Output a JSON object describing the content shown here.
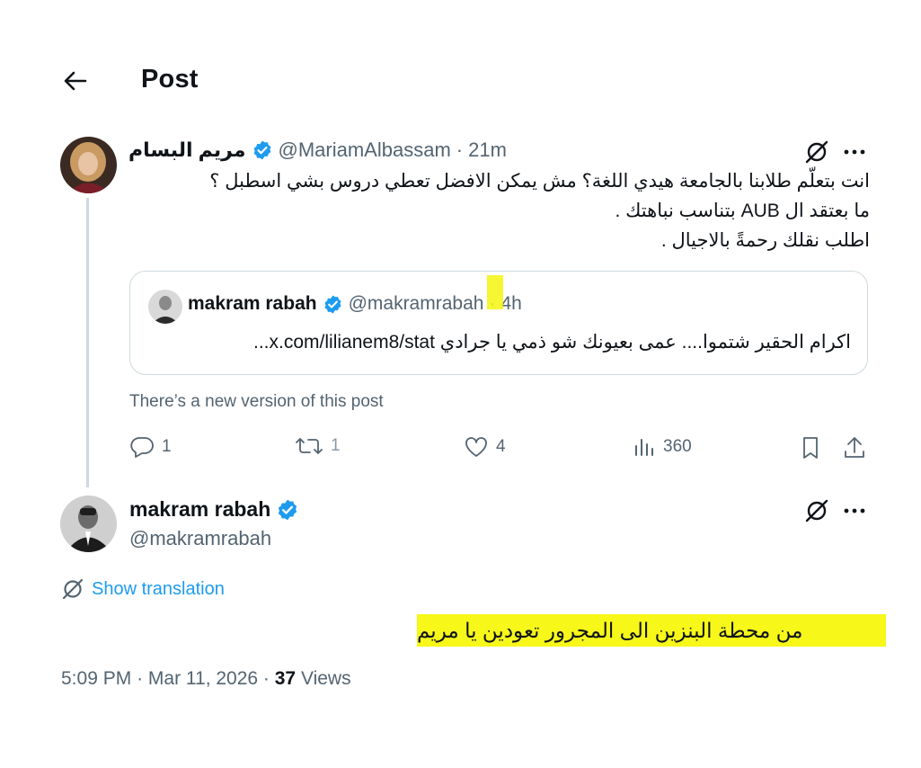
{
  "header": {
    "title": "Post"
  },
  "parent_post": {
    "author_name": "مريم البسام",
    "handle": "@MariamAlbassam",
    "separator": "·",
    "time": "21m",
    "text_lines": [
      "انت بتعلّم طلابنا بالجامعة هيدي اللغة؟ مش يمكن الافضل تعطي دروس بشي اسطبل ؟",
      "ما بعتقد ال AUB بتناسب نباهتك .",
      "اطلب نقلك رحمةً بالاجيال ."
    ],
    "quote": {
      "author_name": "makram rabah",
      "handle": "@makramrabah",
      "separator": "·",
      "time": "4h",
      "text": "اكرام الحقير شتموا.... عمى بعيونك شو ذمي يا جرادي x.com/lilianem8/stat..."
    },
    "new_version_notice": "There’s a new version of this post",
    "actions": {
      "replies": "1",
      "reposts": "1",
      "likes": "4",
      "views": "360"
    }
  },
  "main_post": {
    "author_name": "makram rabah",
    "handle": "@makramrabah",
    "show_translation": "Show translation",
    "text": "من محطة البنزين الى المجرور تعودين يا مريم",
    "time": "5:09 PM",
    "date": "Mar 11, 2026",
    "views_count": "37",
    "views_label": "Views"
  },
  "colors": {
    "verified": "#1d9bf0",
    "link": "#1d9bf0",
    "muted": "#536471",
    "highlight": "#f7f71a"
  },
  "icons": [
    "back-arrow-icon",
    "verified-badge-icon",
    "grok-icon",
    "more-icon",
    "reply-icon",
    "repost-icon",
    "like-icon",
    "views-icon",
    "bookmark-icon",
    "share-icon",
    "translate-icon"
  ]
}
